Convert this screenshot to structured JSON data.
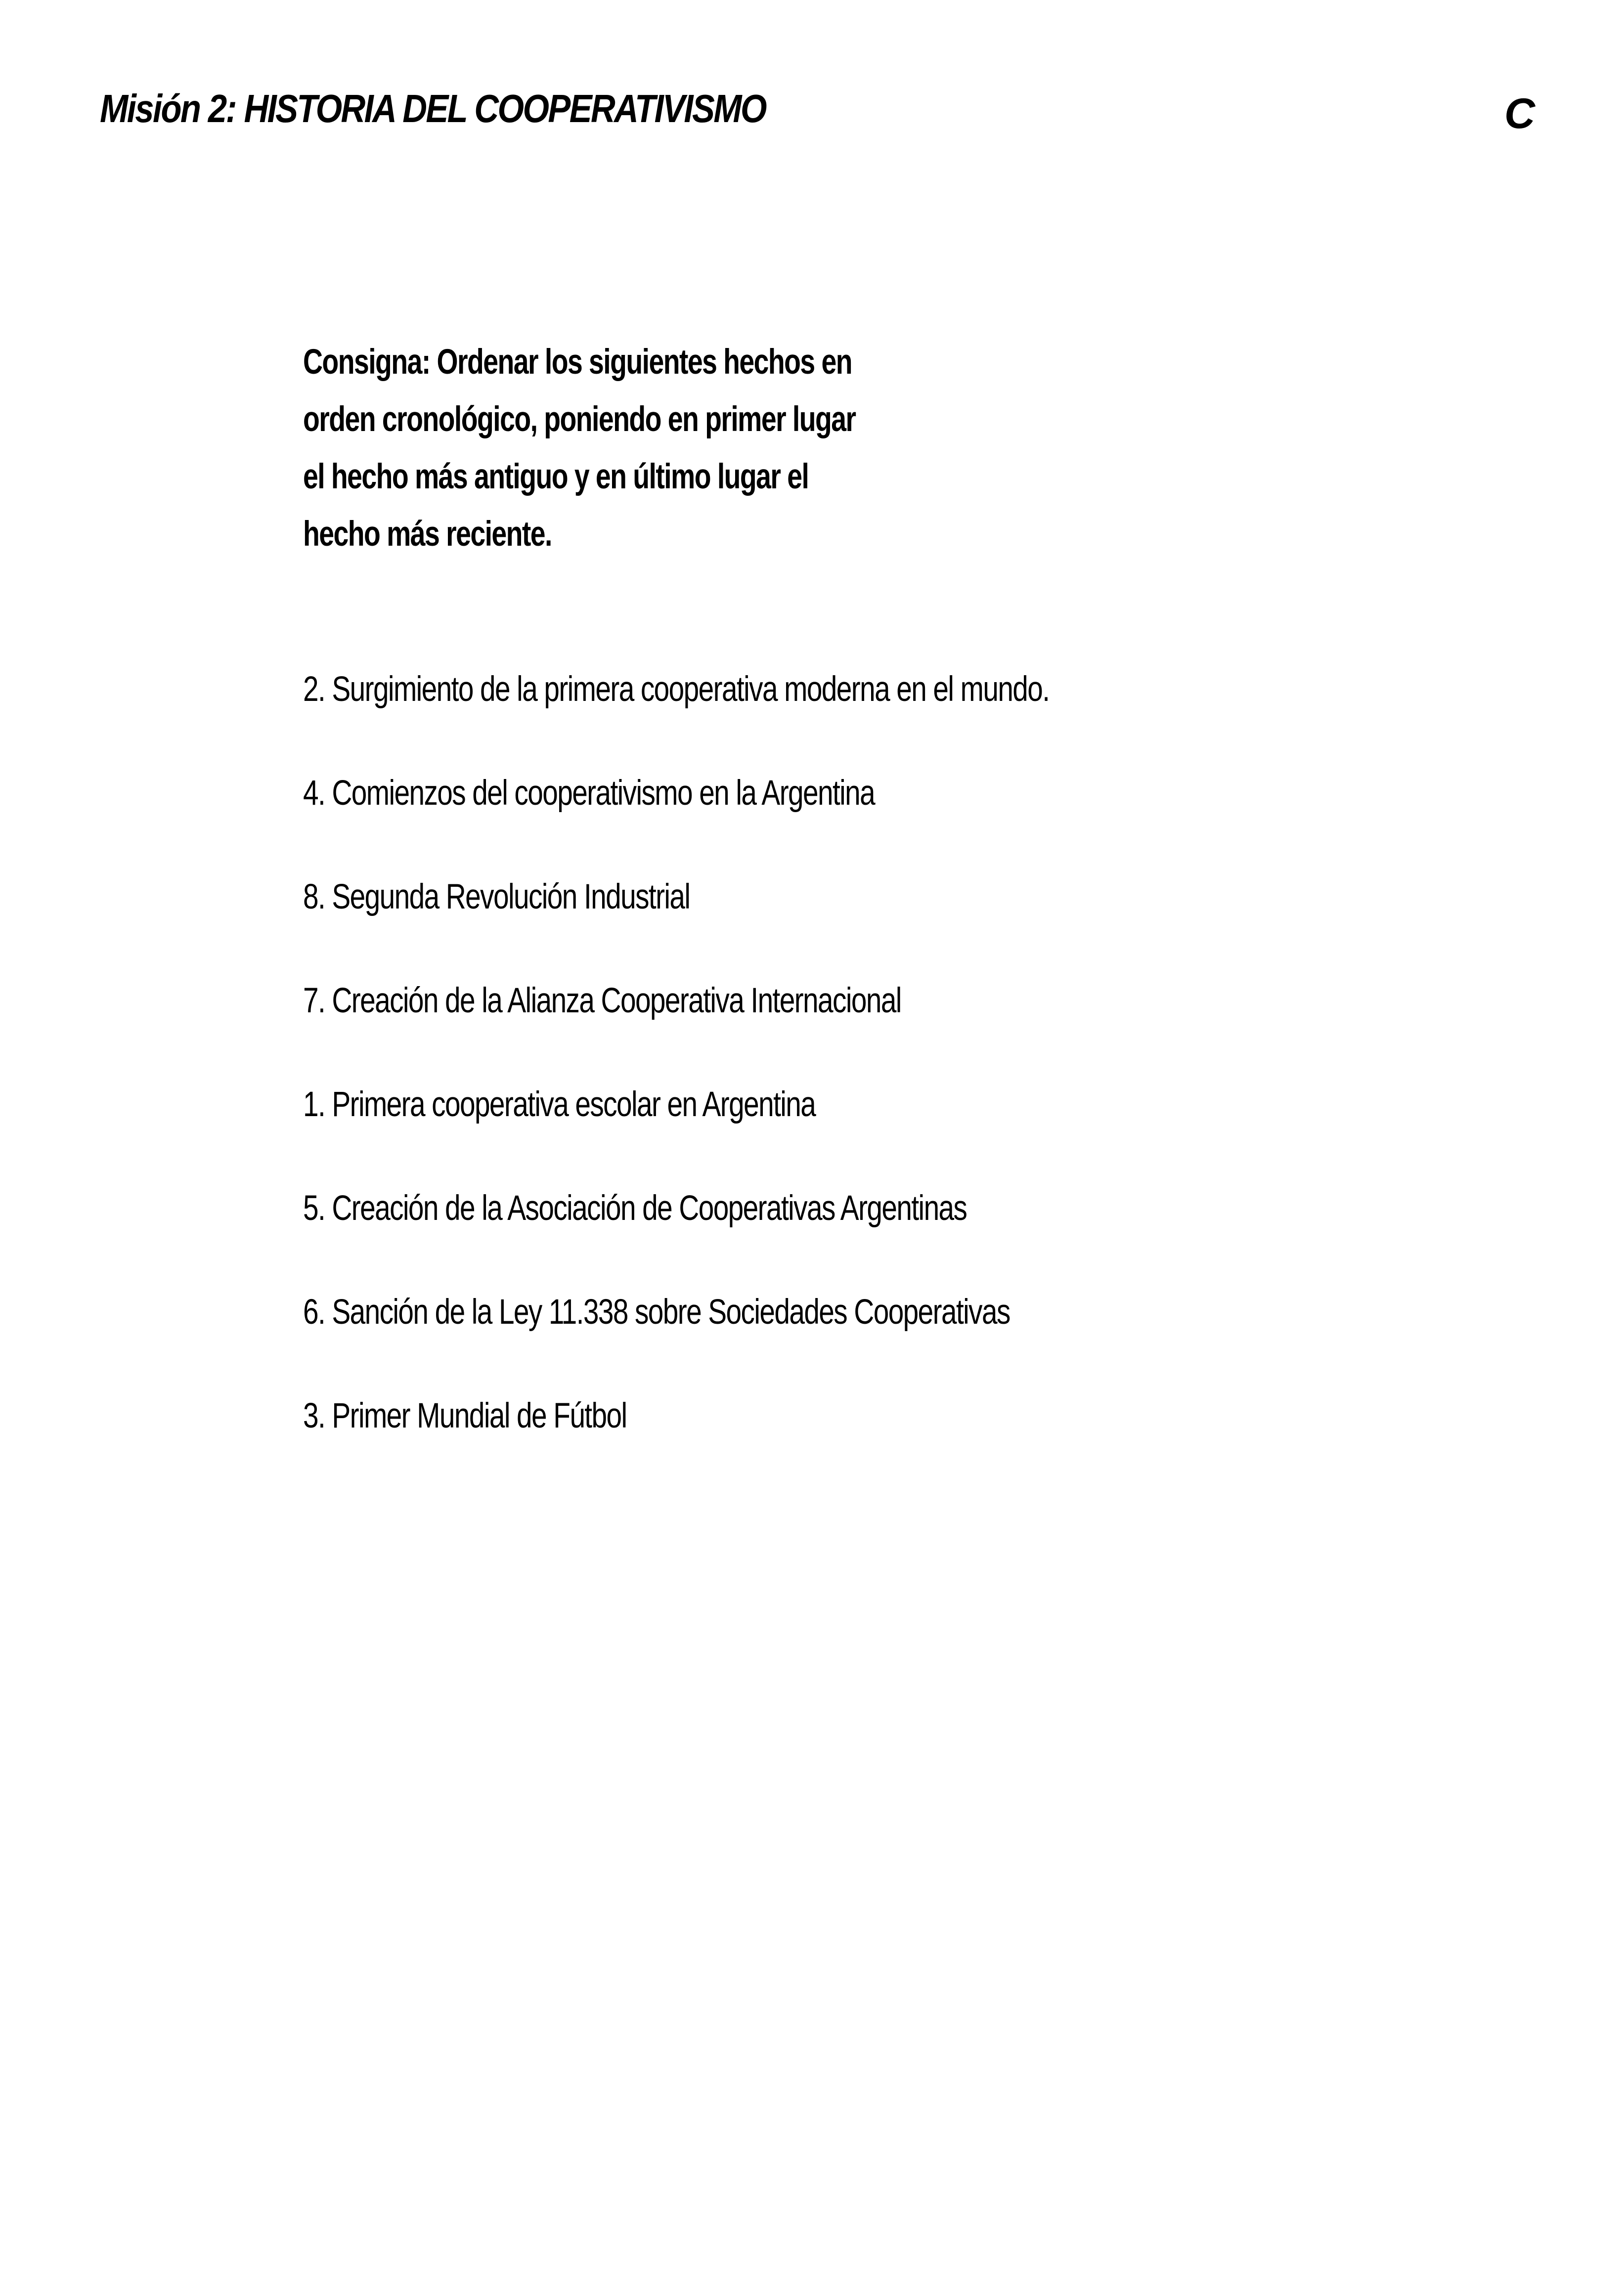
{
  "header": {
    "title": "Misión 2: HISTORIA DEL COOPERATIVISMO",
    "letter": "C"
  },
  "instruction": {
    "text": "Consigna: Ordenar los siguientes hechos en orden cronológico, poniendo en primer lugar el hecho más antiguo y en último lugar el hecho más reciente."
  },
  "events": [
    "2. Surgimiento de la primera cooperativa moderna en el mundo.",
    "4. Comienzos del cooperativismo en la Argentina",
    "8. Segunda Revolución Industrial",
    "7. Creación de la Alianza Cooperativa Internacional",
    "1. Primera cooperativa escolar en Argentina",
    "5. Creación de la Asociación de Cooperativas Argentinas",
    "6. Sanción de la Ley 11.338 sobre Sociedades Cooperativas",
    "3. Primer Mundial de Fútbol"
  ]
}
